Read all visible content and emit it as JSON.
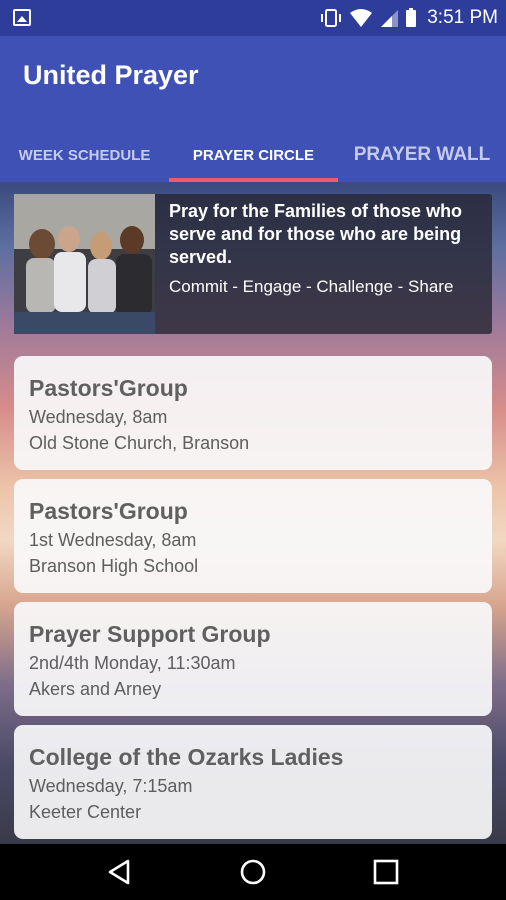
{
  "status_bar": {
    "time": "3:51 PM",
    "icons": [
      "image-notification-icon",
      "vibrate-icon",
      "wifi-icon",
      "signal-icon",
      "battery-icon"
    ]
  },
  "app": {
    "title": "United Prayer"
  },
  "tabs": [
    {
      "label": "WEEK SCHEDULE",
      "selected": false
    },
    {
      "label": "PRAYER CIRCLE",
      "selected": true
    },
    {
      "label": "PRAYER WALL",
      "selected": false
    }
  ],
  "banner": {
    "headline": "Pray for the Families of those who serve and for those who are being served.",
    "tagline": "Commit - Engage - Challenge - Share"
  },
  "groups": [
    {
      "name": "Pastors'Group",
      "schedule": "Wednesday, 8am",
      "location": "Old Stone Church, Branson"
    },
    {
      "name": "Pastors'Group",
      "schedule": "1st Wednesday, 8am",
      "location": "Branson High School"
    },
    {
      "name": "Prayer Support Group",
      "schedule": "2nd/4th Monday, 11:30am",
      "location": "Akers and Arney"
    },
    {
      "name": "College of the Ozarks Ladies",
      "schedule": "Wednesday, 7:15am",
      "location": "Keeter Center"
    }
  ],
  "nav": {
    "icons": [
      "back-icon",
      "home-icon",
      "recents-icon"
    ]
  },
  "colors": {
    "app_bar": "#3f51b5",
    "status_bar": "#2e3d9a",
    "tab_indicator": "#f15a6b"
  }
}
